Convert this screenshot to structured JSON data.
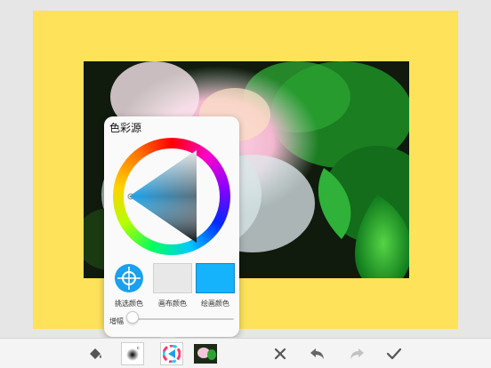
{
  "popover": {
    "title": "色彩源",
    "swatches": [
      {
        "label": "挑选颜色",
        "color": "#19a0ee"
      },
      {
        "label": "画布颜色",
        "color": "#e8e8e8"
      },
      {
        "label": "绘画颜色",
        "color": "#15b3fb"
      }
    ],
    "slider_label": "增幅",
    "slider_value": 0
  },
  "colors": {
    "canvas_bg": "#fde25a",
    "accent": "#19a0ee"
  },
  "toolbar": {
    "icons": [
      "fill-bucket-icon",
      "brush-preview-icon",
      "color-wheel-icon",
      "photo-thumbnail-icon",
      "close-icon",
      "undo-icon",
      "redo-icon",
      "check-icon"
    ]
  }
}
